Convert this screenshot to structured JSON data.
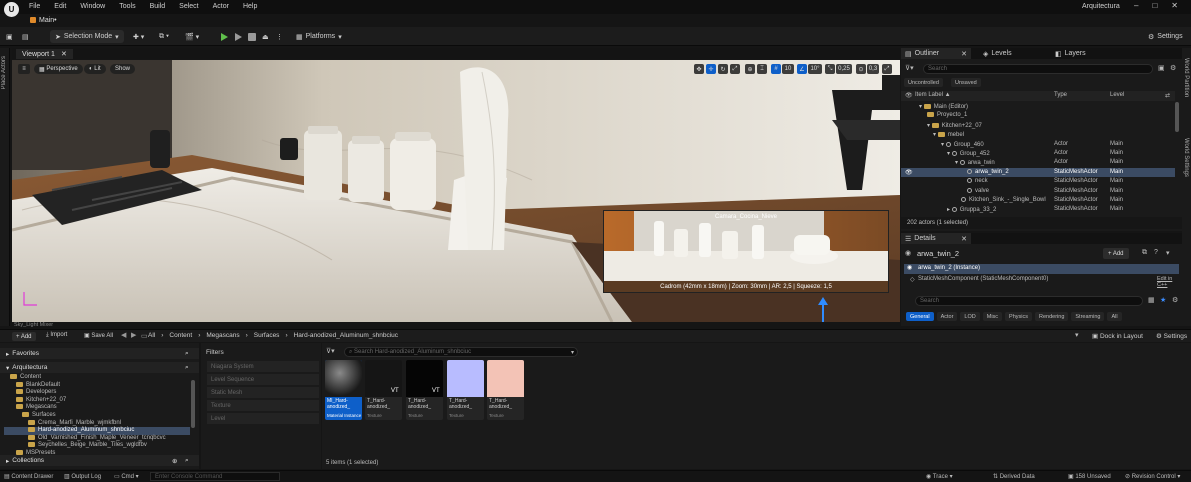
{
  "app": {
    "logo": "U",
    "project_name": "Arquitectura",
    "document_tab": "Main•"
  },
  "menu": [
    "File",
    "Edit",
    "Window",
    "Tools",
    "Build",
    "Select",
    "Actor",
    "Help"
  ],
  "window_controls": [
    "–",
    "□",
    "✕"
  ],
  "toolbar": {
    "selection_mode": "Selection Mode",
    "platforms": "Platforms",
    "settings": "Settings"
  },
  "left_strip": {
    "label": "Place Actors"
  },
  "right_strip": {
    "label1": "World Partition",
    "label2": "World Settings"
  },
  "viewport": {
    "tab": "Viewport 1",
    "perspective": "Perspective",
    "lit": "Lit",
    "show": "Show",
    "grid_value": "10",
    "rotate_value": "10°",
    "scale_value": "0,25",
    "camera_speed": "0,3",
    "pip_caption": "Camara_Cocina_Nieve",
    "pip_info": "Cadrom (42mm x 18mm) | Zoom: 30mm | AR: 2,5 | Squeeze: 1,5",
    "light_label": "Sky_Light Mixer"
  },
  "outliner": {
    "tabs": [
      "Outliner",
      "Levels",
      "Layers"
    ],
    "search_placeholder": "Search",
    "chips": [
      "Uncontrolled",
      "Unsaved"
    ],
    "columns": {
      "label": "Item Label ▲",
      "type": "Type",
      "level": "Level"
    },
    "rows": [
      {
        "label": "Main (Editor)",
        "type": "",
        "level": ""
      },
      {
        "label": "Proyecto_1",
        "type": "",
        "level": ""
      },
      {
        "label": "Kitchen+22_07",
        "type": "",
        "level": ""
      },
      {
        "label": "mebel",
        "type": "",
        "level": ""
      },
      {
        "label": "Group_460",
        "type": "Actor",
        "level": "Main"
      },
      {
        "label": "Group_452",
        "type": "Actor",
        "level": "Main"
      },
      {
        "label": "arwa_twin",
        "type": "Actor",
        "level": "Main"
      },
      {
        "label": "arwa_twin_2",
        "type": "StaticMeshActor",
        "level": "Main"
      },
      {
        "label": "neck",
        "type": "StaticMeshActor",
        "level": "Main"
      },
      {
        "label": "valve",
        "type": "StaticMeshActor",
        "level": "Main"
      },
      {
        "label": "Kitchen_Sink_-_Single_Bowl",
        "type": "StaticMeshActor",
        "level": "Main"
      },
      {
        "label": "Gruppa_33_2",
        "type": "StaticMeshActor",
        "level": "Main"
      }
    ],
    "count": "202 actors (1 selected)"
  },
  "details": {
    "tab": "Details",
    "object_name": "arwa_twin_2",
    "add": "+ Add",
    "instance": "arwa_twin_2 (Instance)",
    "component": "StaticMeshComponent (StaticMeshComponent0)",
    "edit_cpp": "Edit in C++",
    "search_placeholder": "Search",
    "categories": [
      "General",
      "Actor",
      "LOD",
      "Misc",
      "Physics",
      "Rendering",
      "Streaming",
      "All"
    ]
  },
  "content_browser": {
    "add": "+ Add",
    "import": "Import",
    "save_all": "Save All",
    "path": [
      "All",
      "Content",
      "Megascans",
      "Surfaces",
      "Hard-anodized_Aluminum_shnbciuc"
    ],
    "dock": "Dock in Layout",
    "settings": "Settings",
    "favorites": "Favorites",
    "project": "Arquitectura",
    "collections": "Collections",
    "tree": [
      {
        "label": "Content",
        "indent": 1
      },
      {
        "label": "BlankDefault",
        "indent": 2
      },
      {
        "label": "Developers",
        "indent": 2
      },
      {
        "label": "Kitchen+22_07",
        "indent": 2
      },
      {
        "label": "Megascans",
        "indent": 2
      },
      {
        "label": "Surfaces",
        "indent": 3
      },
      {
        "label": "Crema_Marfi_Marble_wjmkfbnl",
        "indent": 4
      },
      {
        "label": "Hard-anodized_Aluminum_shnbciuc",
        "indent": 4
      },
      {
        "label": "Old_Varnished_Finish_Maple_Veneer_tcnqbcvc",
        "indent": 4
      },
      {
        "label": "Seychelles_Beige_Marble_Tiles_wgldfbv",
        "indent": 4
      },
      {
        "label": "MSPresets",
        "indent": 2
      }
    ],
    "filters_title": "Filters",
    "filters": [
      "Niagara System",
      "Level Sequence",
      "Static Mesh",
      "Texture",
      "Level"
    ],
    "asset_search_placeholder": "Search Hard-anodized_Aluminum_shnbciuc",
    "assets": [
      {
        "name1": "MI_Hard-",
        "name2": "anodized_",
        "type": "Material Instance"
      },
      {
        "name1": "T_Hard-",
        "name2": "anodized_",
        "type": "Texture"
      },
      {
        "name1": "T_Hard-",
        "name2": "anodized_",
        "type": "Texture"
      },
      {
        "name1": "T_Hard-",
        "name2": "anodized_",
        "type": "Texture"
      },
      {
        "name1": "T_Hard-",
        "name2": "anodized_",
        "type": "Texture"
      }
    ],
    "vt": "VT",
    "item_count": "5 items (1 selected)"
  },
  "status": {
    "content_drawer": "Content Drawer",
    "output_log": "Output Log",
    "cmd": "Cmd",
    "console_placeholder": "Enter Console Command",
    "trace": "Trace",
    "derived_data": "Derived Data",
    "unsaved": "158 Unsaved",
    "revision": "Revision Control"
  },
  "colors": {
    "accent_blue": "#0e5fc9",
    "selection": "#3b4b63",
    "play_green": "#5fbf4b",
    "folder": "#c9a44a"
  }
}
